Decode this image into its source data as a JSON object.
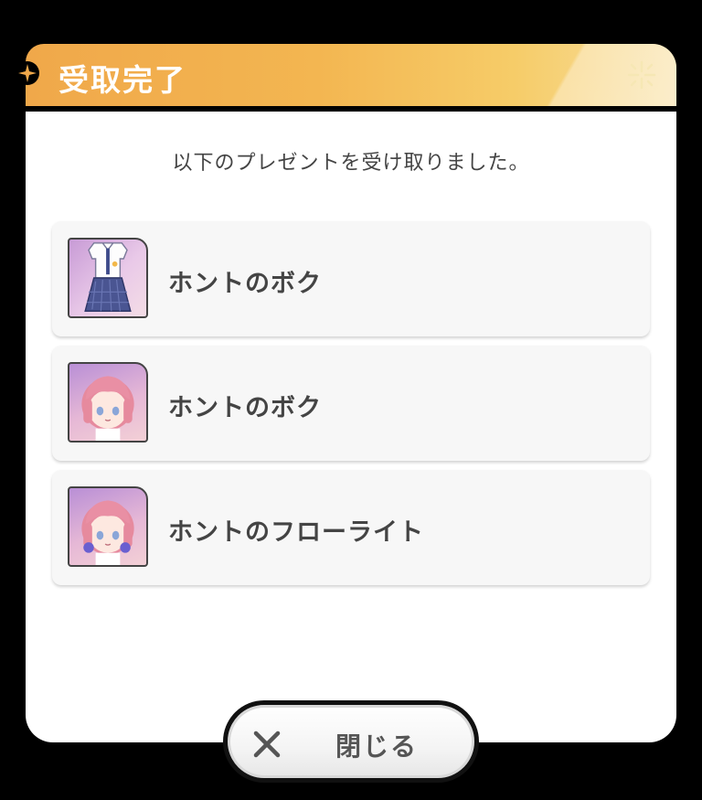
{
  "dialog": {
    "title": "受取完了",
    "message": "以下のプレゼントを受け取りました。"
  },
  "items": [
    {
      "name": "ホントのボク",
      "icon": "costume-outfit-icon"
    },
    {
      "name": "ホントのボク",
      "icon": "character-hair-icon"
    },
    {
      "name": "ホントのフローライト",
      "icon": "character-accessory-icon"
    }
  ],
  "close_button": {
    "label": "閉じる",
    "icon": "close-icon"
  },
  "colors": {
    "header_start": "#f0a84a",
    "header_end": "#f8dfa0",
    "panel": "#ffffff",
    "item_bg": "#f7f7f7",
    "text": "#444444"
  }
}
